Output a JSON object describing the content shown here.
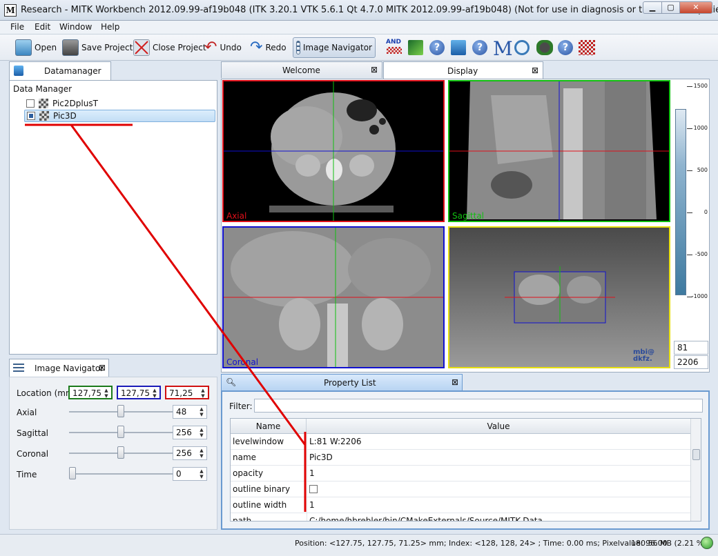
{
  "window": {
    "title": "Research - MITK Workbench 2012.09.99-af19b048 (ITK 3.20.1  VTK 5.6.1 Qt 4.7.0 MITK 2012.09.99-af19b048) (Not for use in diagnosis or treatment of patients)",
    "app_icon_letter": "M"
  },
  "menu": [
    "File",
    "Edit",
    "Window",
    "Help"
  ],
  "toolbar": {
    "open": "Open",
    "save_project": "Save Project",
    "close_project": "Close Project",
    "undo": "Undo",
    "redo": "Redo",
    "image_navigator": "Image Navigator",
    "and_icon_text": "AND",
    "m_icon_text": "M",
    "help_glyph": "?"
  },
  "datamanager": {
    "tab": "Datamanager",
    "header": "Data Manager",
    "items": [
      {
        "label": "Pic2DplusT",
        "selected": false
      },
      {
        "label": "Pic3D",
        "selected": true
      }
    ]
  },
  "image_navigator": {
    "tab": "Image Navigator",
    "location_label": "Location (mm)",
    "location": [
      "127,75",
      "127,75",
      "71,25"
    ],
    "rows": [
      {
        "label": "Axial",
        "value": "48",
        "fraction": 0.5
      },
      {
        "label": "Sagittal",
        "value": "256",
        "fraction": 0.5
      },
      {
        "label": "Coronal",
        "value": "256",
        "fraction": 0.5
      },
      {
        "label": "Time",
        "value": "0",
        "fraction": 0.0
      }
    ]
  },
  "editor_tabs": [
    "Welcome",
    "Display"
  ],
  "views": {
    "axial": "Axial",
    "sagittal": "Sagittal",
    "coronal": "Coronal",
    "logo_line1": "mbi@",
    "logo_line2": "dkfz."
  },
  "level_window": {
    "ticks": [
      "1500",
      "1000",
      "500",
      "0",
      "-500",
      "-1000"
    ],
    "level": "81",
    "window": "2206"
  },
  "property_list": {
    "tab": "Property List",
    "filter_label": "Filter:",
    "columns": [
      "Name",
      "Value"
    ],
    "rows": [
      {
        "name": "levelwindow",
        "value": "L:81 W:2206"
      },
      {
        "name": "name",
        "value": "Pic3D"
      },
      {
        "name": "opacity",
        "value": "1"
      },
      {
        "name": "outline binary",
        "value": ""
      },
      {
        "name": "outline width",
        "value": "1"
      },
      {
        "name": "path",
        "value": "C:/home/hbrebler/bin/CMakeExternals/Source/MITK-Data"
      }
    ]
  },
  "status": {
    "position": "Position: <127.75, 127.75, 71.25> mm; Index: <128, 128, 24> ; Time: 0.00 ms; Pixelvalue: 96.00",
    "memory": "180.56 MB (2.21 %)"
  },
  "colors": {
    "axial": "#e0101a",
    "sagittal": "#10c010",
    "coronal": "#1010d0",
    "render3d": "#e8e010",
    "annotation": "#e00000"
  }
}
